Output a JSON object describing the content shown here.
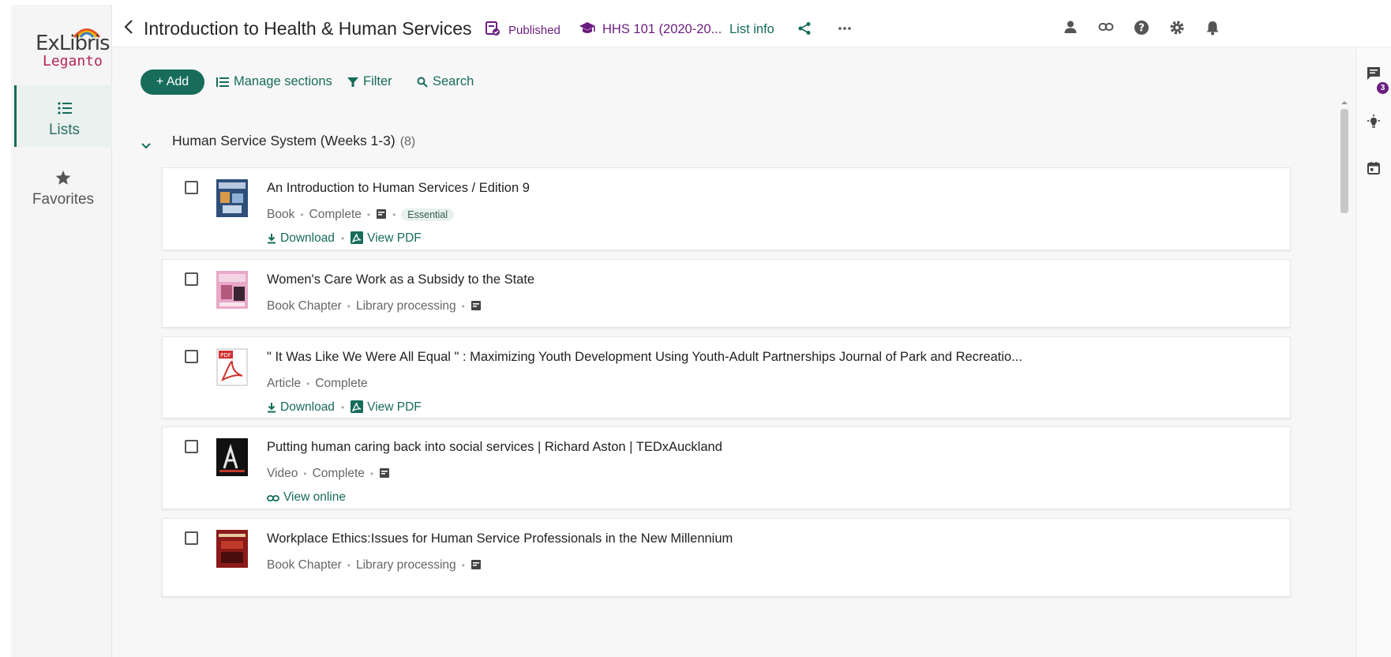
{
  "brand": {
    "top": "ExLibris",
    "bottom": "Leganto"
  },
  "sidebar": {
    "items": [
      {
        "label": "Lists",
        "icon": "list-icon",
        "active": true
      },
      {
        "label": "Favorites",
        "icon": "star-icon",
        "active": false
      }
    ]
  },
  "header": {
    "title": "Introduction to Health & Human Services",
    "status": "Published",
    "course": "HHS 101 (2020-20...",
    "list_info": "List info"
  },
  "toolbar": {
    "add": "+ Add",
    "manage": "Manage sections",
    "filter": "Filter",
    "search": "Search"
  },
  "rail": {
    "comments_badge": "3"
  },
  "section": {
    "title": "Human Service System (Weeks 1-3)",
    "count": "(8)"
  },
  "items": [
    {
      "title": "An Introduction to Human Services / Edition 9",
      "type": "Book",
      "status": "Complete",
      "tag": "Essential",
      "download": "Download",
      "view_pdf": "View PDF"
    },
    {
      "title": "Women's Care Work as a Subsidy to the State",
      "type": "Book Chapter",
      "status": "Library processing"
    },
    {
      "title": "\" It Was Like We Were All Equal \" : Maximizing Youth Development Using Youth-Adult Partnerships Journal of Park and Recreatio...",
      "type": "Article",
      "status": "Complete",
      "download": "Download",
      "view_pdf": "View PDF"
    },
    {
      "title": "Putting human caring back into social services | Richard Aston | TEDxAuckland",
      "type": "Video",
      "status": "Complete",
      "view_online": "View online"
    },
    {
      "title": "Workplace Ethics:Issues for Human Service Professionals in the New Millennium",
      "type": "Book Chapter",
      "status": "Library processing"
    }
  ],
  "colors": {
    "accent": "#176c5b",
    "published": "#6b1d7f",
    "brand_red": "#b3245a"
  }
}
